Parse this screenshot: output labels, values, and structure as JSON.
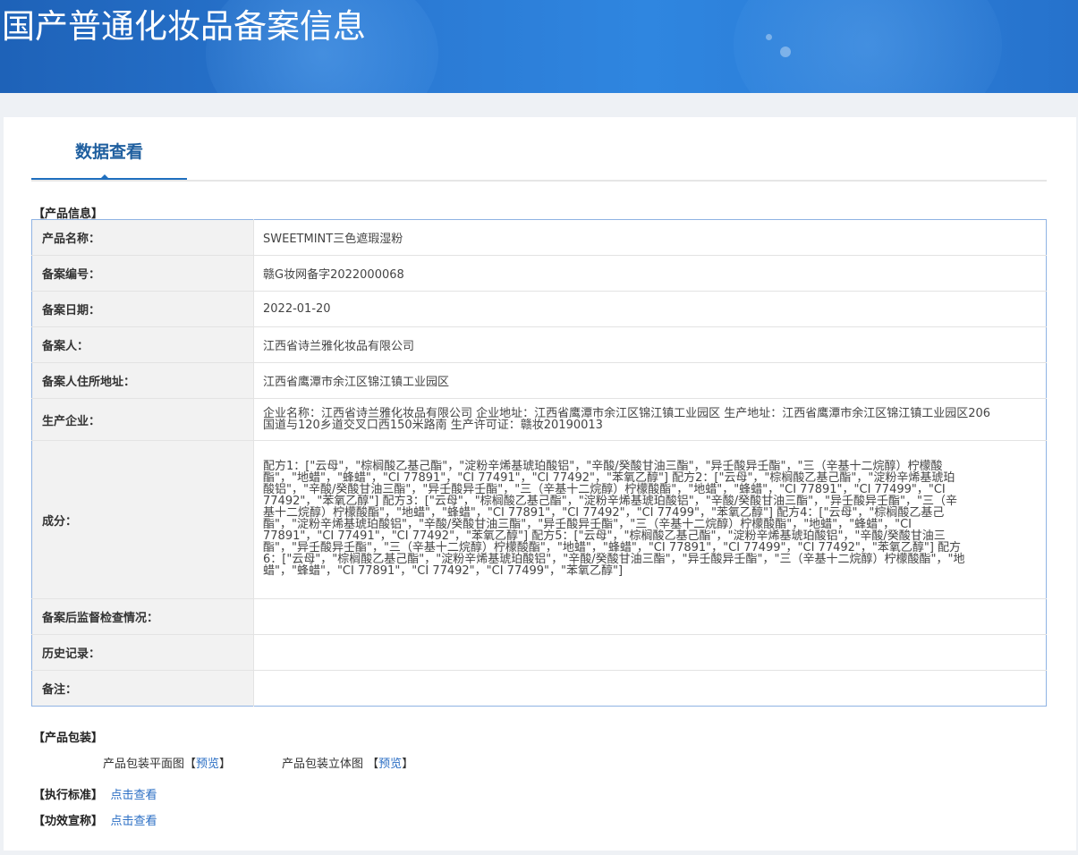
{
  "banner": {
    "title": "国产普通化妆品备案信息"
  },
  "tab": {
    "label": "数据查看"
  },
  "sections": {
    "product_info": "【产品信息】",
    "packaging": "【产品包装】",
    "standard": "【执行标准】",
    "efficacy": "【功效宣称】"
  },
  "info_rows": [
    {
      "label": "产品名称：",
      "value": "SWEETMINT三色遮瑕湿粉"
    },
    {
      "label": "备案编号：",
      "value": "赣G妆网备字2022000068"
    },
    {
      "label": "备案日期：",
      "value": "2022-01-20"
    },
    {
      "label": "备案人：",
      "value": "江西省诗兰雅化妆品有限公司"
    },
    {
      "label": "备案人住所地址：",
      "value": "江西省鹰潭市余江区锦江镇工业园区"
    },
    {
      "label": "生产企业：",
      "value": "企业名称：江西省诗兰雅化妆品有限公司 企业地址：江西省鹰潭市余江区锦江镇工业园区 生产地址：江西省鹰潭市余江区锦江镇工业园区206国道与120乡道交叉口西150米路南 生产许可证：赣妆20190013"
    },
    {
      "label": "成分：",
      "value": "配方1：[\"云母\"，\"棕榈酸乙基己酯\"，\"淀粉辛烯基琥珀酸铝\"，\"辛酸/癸酸甘油三酯\"，\"异壬酸异壬酯\"，\"三（辛基十二烷醇）柠檬酸酯\"，\"地蜡\"，\"蜂蜡\"，\"CI 77891\"，\"CI 77491\"，\"CI 77492\"，\"苯氧乙醇\"] 配方2：[\"云母\"，\"棕榈酸乙基己酯\"，\"淀粉辛烯基琥珀酸铝\"，\"辛酸/癸酸甘油三酯\"，\"异壬酸异壬酯\"，\"三（辛基十二烷醇）柠檬酸酯\"，\"地蜡\"，\"蜂蜡\"，\"CI 77891\"，\"CI 77499\"，\"CI 77492\"，\"苯氧乙醇\"] 配方3：[\"云母\"，\"棕榈酸乙基己酯\"，\"淀粉辛烯基琥珀酸铝\"，\"辛酸/癸酸甘油三酯\"，\"异壬酸异壬酯\"，\"三（辛基十二烷醇）柠檬酸酯\"，\"地蜡\"，\"蜂蜡\"，\"CI 77891\"，\"CI 77492\"，\"CI 77499\"，\"苯氧乙醇\"] 配方4：[\"云母\"，\"棕榈酸乙基己酯\"，\"淀粉辛烯基琥珀酸铝\"，\"辛酸/癸酸甘油三酯\"，\"异壬酸异壬酯\"，\"三（辛基十二烷醇）柠檬酸酯\"，\"地蜡\"，\"蜂蜡\"，\"CI 77891\"，\"CI 77491\"，\"CI 77492\"，\"苯氧乙醇\"] 配方5：[\"云母\"，\"棕榈酸乙基己酯\"，\"淀粉辛烯基琥珀酸铝\"，\"辛酸/癸酸甘油三酯\"，\"异壬酸异壬酯\"，\"三（辛基十二烷醇）柠檬酸酯\"，\"地蜡\"，\"蜂蜡\"，\"CI 77891\"，\"CI 77499\"，\"CI 77492\"，\"苯氧乙醇\"] 配方6：[\"云母\"，\"棕榈酸乙基己酯\"，\"淀粉辛烯基琥珀酸铝\"，\"辛酸/癸酸甘油三酯\"，\"异壬酸异壬酯\"，\"三（辛基十二烷醇）柠檬酸酯\"，\"地蜡\"，\"蜂蜡\"，\"CI 77891\"，\"CI 77492\"，\"CI 77499\"，\"苯氧乙醇\"]"
    },
    {
      "label": "备案后监督检查情况：",
      "value": ""
    },
    {
      "label": "历史记录：",
      "value": ""
    },
    {
      "label": "备注：",
      "value": ""
    }
  ],
  "packaging": {
    "flat_label": "产品包装平面图",
    "flat_preview": "预览",
    "solid_label": "产品包装立体图",
    "solid_preview": "预览",
    "bracket_open": "【",
    "bracket_close": "】"
  },
  "links": {
    "standard_view": "点击查看",
    "efficacy_view": "点击查看"
  },
  "colors": {
    "banner": "#2a78d2",
    "tab_active": "#1f6fbf",
    "link": "#2a6ec4",
    "table_border": "#8fb3e3"
  }
}
